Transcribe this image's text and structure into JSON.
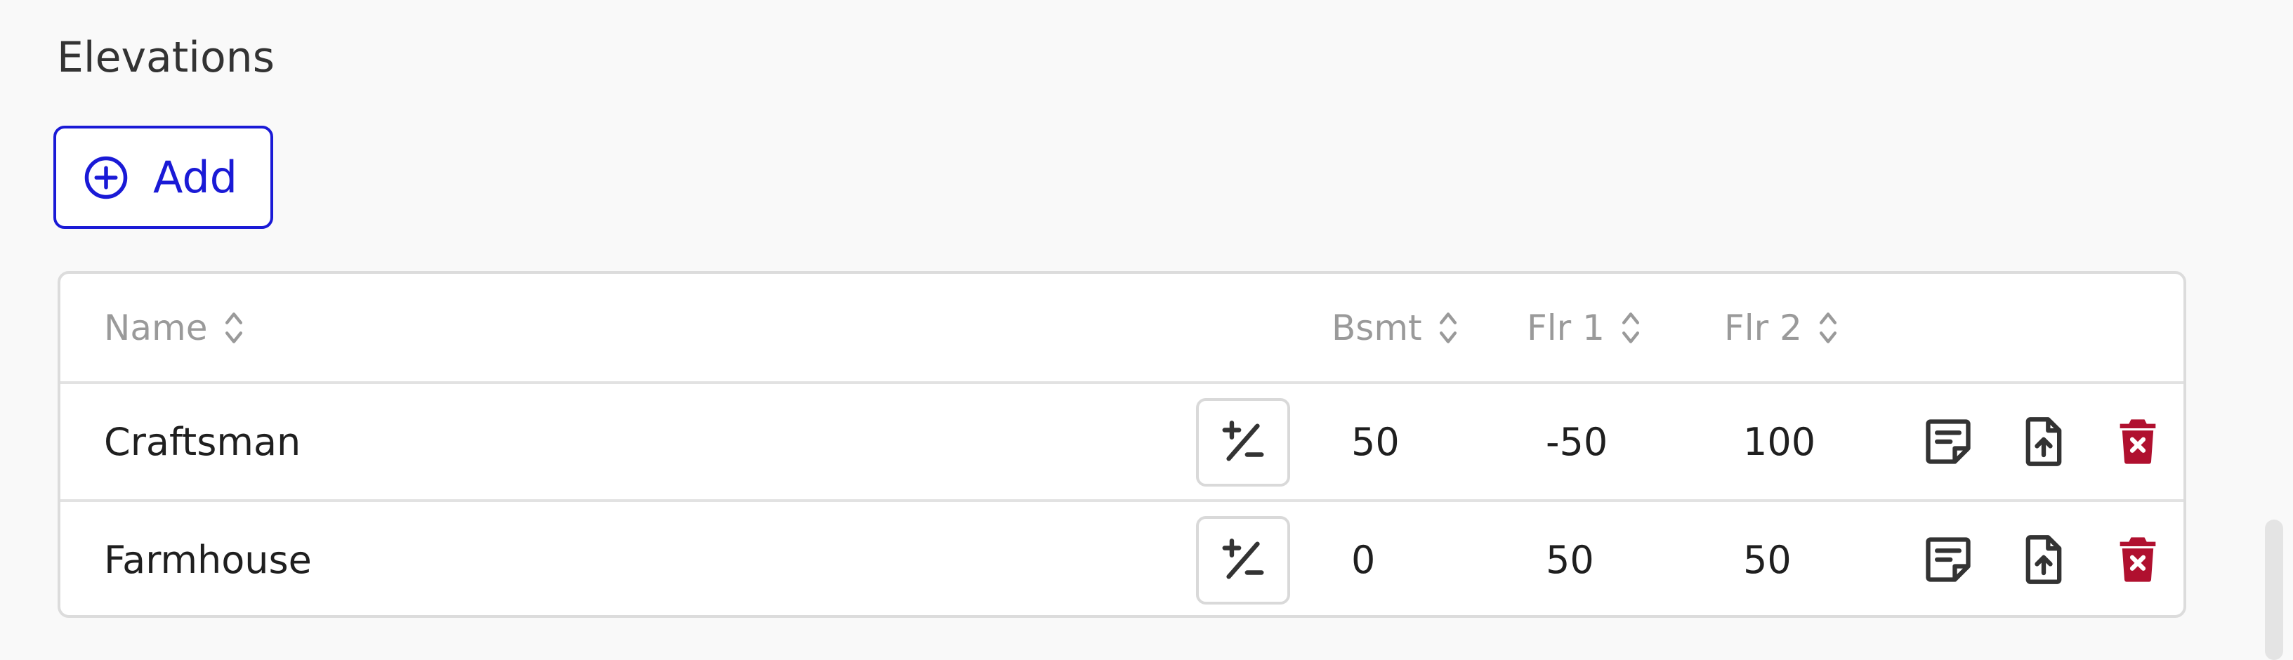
{
  "section": {
    "title": "Elevations",
    "add_label": "Add"
  },
  "table": {
    "columns": {
      "name": "Name",
      "bsmt": "Bsmt",
      "flr1": "Flr 1",
      "flr2": "Flr 2"
    },
    "rows": [
      {
        "name": "Craftsman",
        "bsmt": "50",
        "flr1": "-50",
        "flr2": "100"
      },
      {
        "name": "Farmhouse",
        "bsmt": "0",
        "flr1": "50",
        "flr2": "50"
      }
    ],
    "row_icons": [
      "plus-minus-icon",
      "note-icon",
      "file-upload-icon",
      "delete-icon"
    ]
  },
  "colors": {
    "accent": "#1a1ad6",
    "delete": "#b0102f",
    "header_text": "#9a9a9a",
    "border": "#dcdcdc"
  }
}
